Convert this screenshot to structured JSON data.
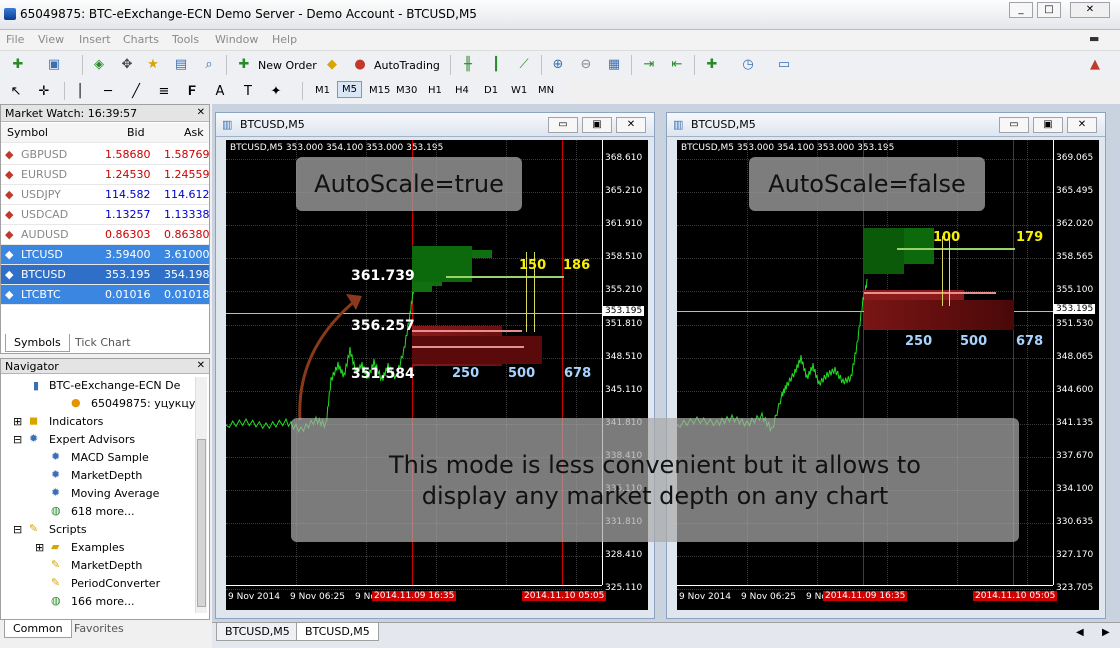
{
  "window": {
    "title": "65049875: BTC-eExchange-ECN Demo Server - Demo Account - BTCUSD,M5"
  },
  "menu": [
    "File",
    "View",
    "Insert",
    "Charts",
    "Tools",
    "Window",
    "Help"
  ],
  "toolbar": {
    "new_order": "New Order",
    "autotrading": "AutoTrading",
    "timeframes": [
      "M1",
      "M5",
      "M15",
      "M30",
      "H1",
      "H4",
      "D1",
      "W1",
      "MN"
    ],
    "text_tool": "A"
  },
  "market_watch": {
    "title": "Market Watch: 16:39:57",
    "headers": [
      "Symbol",
      "Bid",
      "Ask"
    ],
    "rows": [
      {
        "symbol": "GBPUSD",
        "bid": "1.58680",
        "ask": "1.58769"
      },
      {
        "symbol": "EURUSD",
        "bid": "1.24530",
        "ask": "1.24559"
      },
      {
        "symbol": "USDJPY",
        "bid": "114.582",
        "ask": "114.612"
      },
      {
        "symbol": "USDCAD",
        "bid": "1.13257",
        "ask": "1.13338"
      },
      {
        "symbol": "AUDUSD",
        "bid": "0.86303",
        "ask": "0.86380"
      },
      {
        "symbol": "LTCUSD",
        "bid": "3.59400",
        "ask": "3.61000"
      },
      {
        "symbol": "BTCUSD",
        "bid": "353.195",
        "ask": "354.198"
      },
      {
        "symbol": "LTCBTC",
        "bid": "0.01016",
        "ask": "0.01018"
      }
    ],
    "tabs": [
      "Symbols",
      "Tick Chart"
    ]
  },
  "navigator": {
    "title": "Navigator",
    "server": "BTC-eExchange-ECN De",
    "account": "65049875: уцукцук",
    "indicators": "Indicators",
    "experts": "Expert Advisors",
    "expert_items": [
      "MACD Sample",
      "MarketDepth",
      "Moving Average",
      "618 more..."
    ],
    "scripts": "Scripts",
    "script_items": [
      "Examples",
      "MarketDepth",
      "PeriodConverter",
      "166 more..."
    ],
    "tabs": [
      "Common",
      "Favorites"
    ]
  },
  "chart_left": {
    "title": "BTCUSD,M5",
    "info": "BTCUSD,M5  353.000 354.100 353.000 353.195",
    "banner": "AutoScale=true",
    "prices": [
      "368.610",
      "365.210",
      "361.910",
      "358.510",
      "355.210",
      "351.810",
      "348.510",
      "345.110",
      "341.810",
      "338.410",
      "335.110",
      "331.810",
      "328.410",
      "325.110"
    ],
    "current": "353.195",
    "labels": {
      "p1": "361.739",
      "p2": "356.257",
      "p3": "351.584"
    },
    "vols": [
      "150",
      "186",
      "250",
      "500",
      "678"
    ],
    "xlabels": [
      "9 Nov 2014",
      "9 Nov 06:25",
      "9 No"
    ],
    "xred": [
      "2014.11.09 16:35",
      "2014.11.10 05:05"
    ]
  },
  "chart_right": {
    "title": "BTCUSD,M5",
    "info": "BTCUSD,M5  353.000 354.100 353.000 353.195",
    "banner": "AutoScale=false",
    "prices": [
      "369.065",
      "365.495",
      "362.020",
      "358.565",
      "355.100",
      "351.530",
      "348.065",
      "344.600",
      "341.135",
      "337.670",
      "334.100",
      "330.635",
      "327.170",
      "323.705"
    ],
    "current": "353.195",
    "vols": [
      "100",
      "179",
      "250",
      "500",
      "678"
    ],
    "xlabels": [
      "9 Nov 2014",
      "9 Nov 06:25",
      "9 No"
    ],
    "xred": [
      "2014.11.09 16:35",
      "2014.11.10 05:05"
    ]
  },
  "overlay": "This mode is less convenient but it allows to display any market depth on any chart",
  "bottom_tabs": [
    "BTCUSD,M5",
    "BTCUSD,M5"
  ]
}
